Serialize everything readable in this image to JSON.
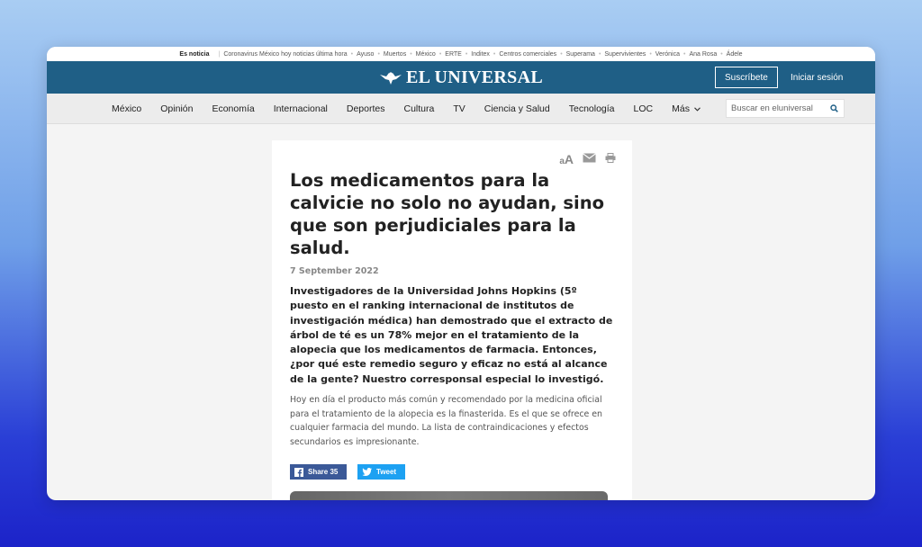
{
  "trending": {
    "lead": "Es noticia",
    "items": [
      "Coronavirus México hoy noticias última hora",
      "Ayuso",
      "Muertos",
      "México",
      "ERTE",
      "Inditex",
      "Centros comerciales",
      "Superama",
      "Supervivientes",
      "Verónica",
      "Ana Rosa",
      "Ádele"
    ]
  },
  "header": {
    "logo_text": "EL UNIVERSAL",
    "subscribe_label": "Suscríbete",
    "login_label": "Iniciar sesión",
    "background_color": "#1f5f86"
  },
  "nav": {
    "items": [
      "México",
      "Opinión",
      "Economía",
      "Internacional",
      "Deportes",
      "Cultura",
      "TV",
      "Ciencia y Salud",
      "Tecnología",
      "LOC"
    ],
    "more_label": "Más",
    "search_placeholder": "Buscar en eluniversal"
  },
  "article": {
    "font_size_icon": "aA",
    "headline": "Los medicamentos para la calvicie no solo no ayudan, sino que son perjudiciales para la salud.",
    "date": "7 September 2022",
    "lede": "Investigadores de la Universidad Johns Hopkins (5º puesto en el ranking internacional de institutos de investigación médica) han demostrado que el extracto de árbol de té es un 78% mejor en el tratamiento de la alopecia que los medicamentos de farmacia. Entonces, ¿por qué este remedio seguro y eficaz no está al alcance de la gente? Nuestro corresponsal especial lo investigó.",
    "body": "Hoy en día el producto más común y recomendado por la medicina oficial para el tratamiento de la alopecia es la finasterida. Es el que se ofrece en cualquier farmacia del mundo. La lista de contraindicaciones y efectos secundarios es impresionante.",
    "share_facebook": "Share 35",
    "share_twitter": "Tweet"
  }
}
